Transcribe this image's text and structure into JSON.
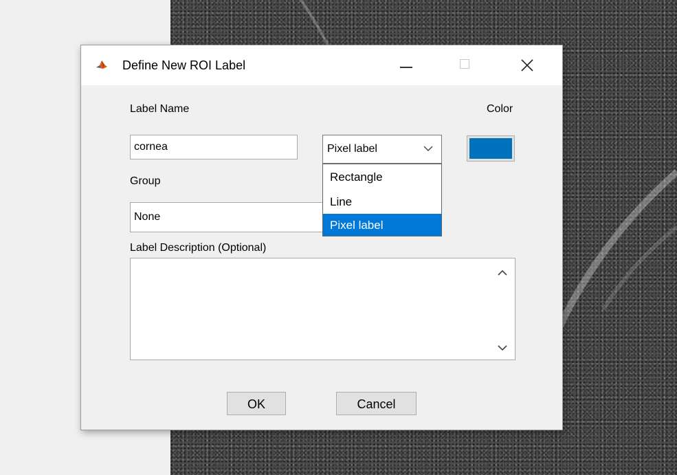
{
  "dialog": {
    "title": "Define New ROI Label",
    "label_name_label": "Label Name",
    "label_name_value": "cornea",
    "color_label": "Color",
    "color_value": "#0072bd",
    "roi_type": {
      "selected": "Pixel label",
      "options": [
        "Rectangle",
        "Line",
        "Pixel label"
      ]
    },
    "group_label": "Group",
    "group_value": "None",
    "description_label": "Label Description (Optional)",
    "description_value": "",
    "ok_label": "OK",
    "cancel_label": "Cancel"
  },
  "icons": {
    "app": "matlab-icon",
    "minimize": "minimize-icon",
    "maximize": "maximize-icon",
    "close": "close-icon"
  },
  "colors": {
    "accent": "#0078d7",
    "swatch": "#0072bd"
  }
}
